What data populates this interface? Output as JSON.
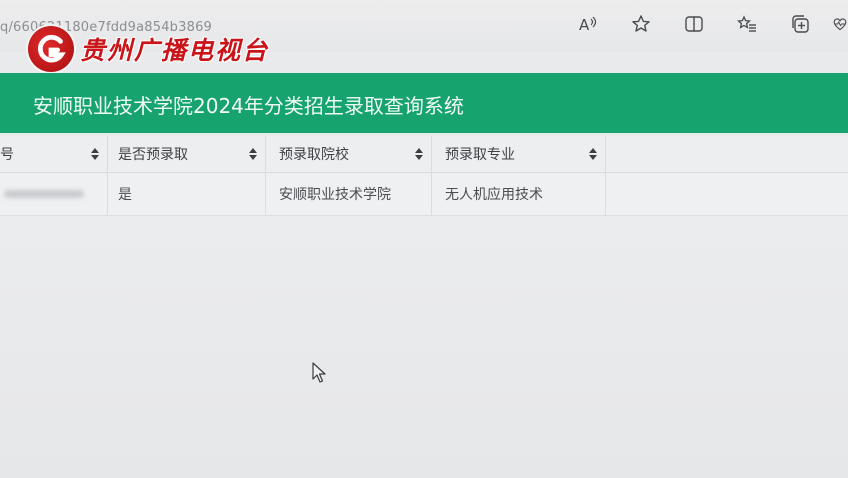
{
  "browser": {
    "url": "q/660621180e7fdd9a854b3869",
    "toolbar_icons": [
      "read-aloud-icon",
      "favorite-star-icon",
      "split-screen-icon",
      "favorites-list-icon",
      "collections-icon",
      "health-icon"
    ]
  },
  "watermark": {
    "logo_text": "贵州广播电视台",
    "brand_color": "#c9141a"
  },
  "header": {
    "title": "安顺职业技术学院2024年分类招生录取查询系统",
    "accent_color": "#17a36d"
  },
  "table": {
    "columns": [
      "号",
      "是否预录取",
      "预录取院校",
      "预录取专业"
    ],
    "rows": [
      {
        "id": "",
        "admitted": "是",
        "school": "安顺职业技术学院",
        "major": "无人机应用技术"
      }
    ]
  }
}
